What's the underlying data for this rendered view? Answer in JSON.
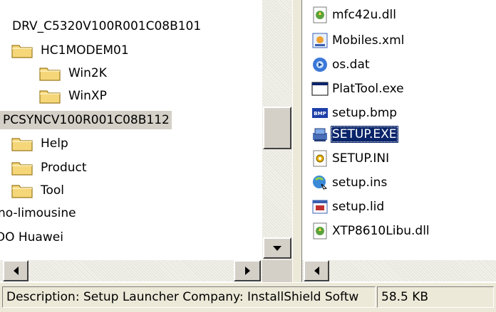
{
  "tree": {
    "items": [
      {
        "label": "DRV_C5320V100R001C08B101",
        "indent": 0,
        "icon": "none"
      },
      {
        "label": "HC1MODEM01",
        "indent": 1,
        "icon": "folder-icon"
      },
      {
        "label": "Win2K",
        "indent": 2,
        "icon": "folder-icon"
      },
      {
        "label": "WinXP",
        "indent": 2,
        "icon": "folder-icon"
      },
      {
        "label": "PCSYNCV100R001C08B112",
        "indent": 0,
        "icon": "none",
        "state": "selected-inactive"
      },
      {
        "label": "Help",
        "indent": 1,
        "icon": "folder-icon"
      },
      {
        "label": "Product",
        "indent": 1,
        "icon": "folder-icon"
      },
      {
        "label": "Tool",
        "indent": 1,
        "icon": "folder-icon"
      },
      {
        "label": "no-limousine",
        "indent": -1,
        "icon": "none"
      },
      {
        "label": "DO Huawei",
        "indent": -1,
        "icon": "none"
      }
    ]
  },
  "files": {
    "items": [
      {
        "label": "mfc42u.dll",
        "icon": "dll-icon"
      },
      {
        "label": "Mobiles.xml",
        "icon": "xml-icon"
      },
      {
        "label": "os.dat",
        "icon": "dat-icon"
      },
      {
        "label": "PlatTool.exe",
        "icon": "exe-window-icon"
      },
      {
        "label": "setup.bmp",
        "icon": "bmp-icon"
      },
      {
        "label": "SETUP.EXE",
        "icon": "installer-exe-icon",
        "state": "selected"
      },
      {
        "label": "SETUP.INI",
        "icon": "ini-icon"
      },
      {
        "label": "setup.ins",
        "icon": "ins-icon"
      },
      {
        "label": "setup.lid",
        "icon": "lid-icon"
      },
      {
        "label": "XTP8610Libu.dll",
        "icon": "dll-icon"
      }
    ]
  },
  "statusbar": {
    "description": "Description: Setup Launcher Company: InstallShield Softw",
    "size": "58.5 KB"
  },
  "colors": {
    "selection": "#0a246a",
    "inactive_selection": "#d4d0c8",
    "folder": "#f5d77a"
  }
}
